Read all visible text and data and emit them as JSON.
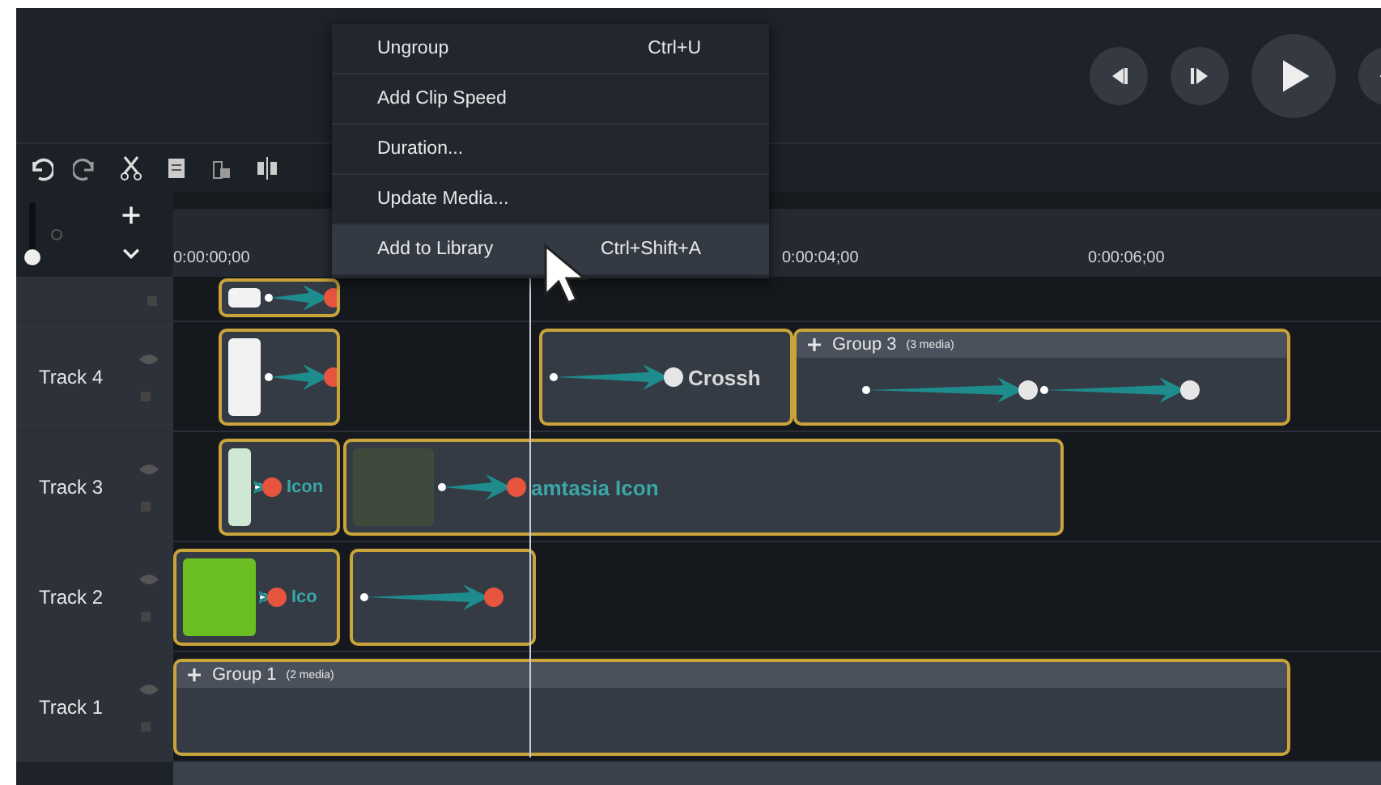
{
  "context_menu": {
    "items": [
      {
        "label": "Ungroup",
        "shortcut": "Ctrl+U",
        "selected": false
      },
      {
        "label": "Add Clip Speed",
        "selected": false
      },
      {
        "label": "Duration...",
        "selected": false
      },
      {
        "label": "Update Media...",
        "selected": false
      },
      {
        "label": "Add to Library",
        "shortcut": "Ctrl+Shift+A",
        "selected": true
      }
    ]
  },
  "zoom": {
    "level": 0.05
  },
  "ruler": {
    "start": "0:00:00;00",
    "ticks": [
      "0:00:04;00",
      "0:00:06;00"
    ]
  },
  "tracks": [
    {
      "clips": [
        {
          "kind": "banner"
        }
      ]
    },
    {
      "name": "Track 4",
      "clips": [
        {
          "kind": "banner"
        },
        {
          "kind": "text",
          "label": "Crossh"
        },
        {
          "kind": "group",
          "label": "Group 3",
          "media": "(3 media)",
          "arrows": true
        }
      ]
    },
    {
      "name": "Track 3",
      "clips": [
        {
          "kind": "image",
          "color": "#cfe8d4",
          "label": "Icon"
        },
        {
          "kind": "logo",
          "label": "amtasia Icon"
        }
      ]
    },
    {
      "name": "Track 2",
      "clips": [
        {
          "kind": "image",
          "color": "#6cbf22",
          "label": "Ico"
        },
        {
          "kind": "animation"
        }
      ]
    },
    {
      "name": "Track 1",
      "clips": [
        {
          "kind": "group",
          "label": "Group 1",
          "media": "(2 media)",
          "arrows": false
        }
      ]
    }
  ]
}
